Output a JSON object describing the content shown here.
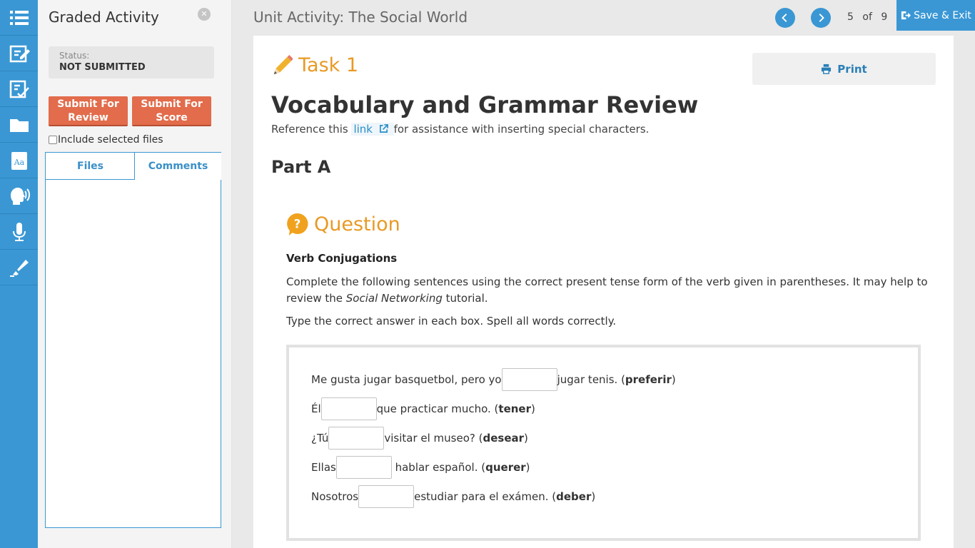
{
  "rail": {
    "items": [
      {
        "name": "menu-list-icon"
      },
      {
        "name": "notes-edit-icon"
      },
      {
        "name": "graded-activity-icon",
        "active": true
      },
      {
        "name": "folder-icon"
      },
      {
        "name": "dictionary-icon"
      },
      {
        "name": "speaking-head-icon"
      },
      {
        "name": "microphone-icon"
      },
      {
        "name": "highlighter-icon"
      }
    ],
    "color": "#3a97d4"
  },
  "panel": {
    "title": "Graded Activity",
    "close_icon": "close-circle-icon",
    "status_label": "Status:",
    "status_value": "NOT SUBMITTED",
    "submit_review_label": "Submit For Review",
    "submit_score_label": "Submit For Score",
    "include_files_label": "Include selected files",
    "include_files_checked": false,
    "tabs": [
      {
        "label": "Files"
      },
      {
        "label": "Comments",
        "selected": true
      }
    ]
  },
  "header": {
    "unit_title": "Unit Activity: The Social World",
    "page_current": "5",
    "page_of": "of",
    "page_total": "9",
    "save_exit_label": "Save & Exit"
  },
  "content": {
    "task_label": "Task 1",
    "print_label": "Print",
    "heading": "Vocabulary and Grammar Review",
    "reference_before": "Reference this",
    "reference_link": "link",
    "reference_after": "for assistance with inserting special characters.",
    "part_label": "Part A",
    "question_label": "Question",
    "question_subtitle": "Verb Conjugations",
    "instructions_1": "Complete the following sentences using the correct present tense form of the verb given in parentheses. It may help to review the",
    "instructions_italic": "Social Networking",
    "instructions_2": "tutorial.",
    "type_instruction": "Type the correct answer in each box. Spell all words correctly.",
    "sentences": [
      {
        "before": "Me gusta jugar basquetbol, pero yo",
        "after": "jugar tenis. (",
        "verb": "preferir",
        "close": ")",
        "answer": ""
      },
      {
        "before": "Él",
        "after": "que practicar mucho. (",
        "verb": "tener",
        "close": ")",
        "answer": ""
      },
      {
        "before": "¿Tú",
        "after": "visitar el museo? (",
        "verb": "desear",
        "close": ")",
        "answer": ""
      },
      {
        "before": "Ellas",
        "after": " hablar español. (",
        "verb": "querer",
        "close": ")",
        "answer": ""
      },
      {
        "before": "Nosotros",
        "after": "estudiar para el exámen. (",
        "verb": "deber",
        "close": ")",
        "answer": ""
      }
    ]
  },
  "colors": {
    "accent_blue": "#3a97d4",
    "submit_orange": "#e26c4b",
    "heading_orange": "#e89a24"
  }
}
